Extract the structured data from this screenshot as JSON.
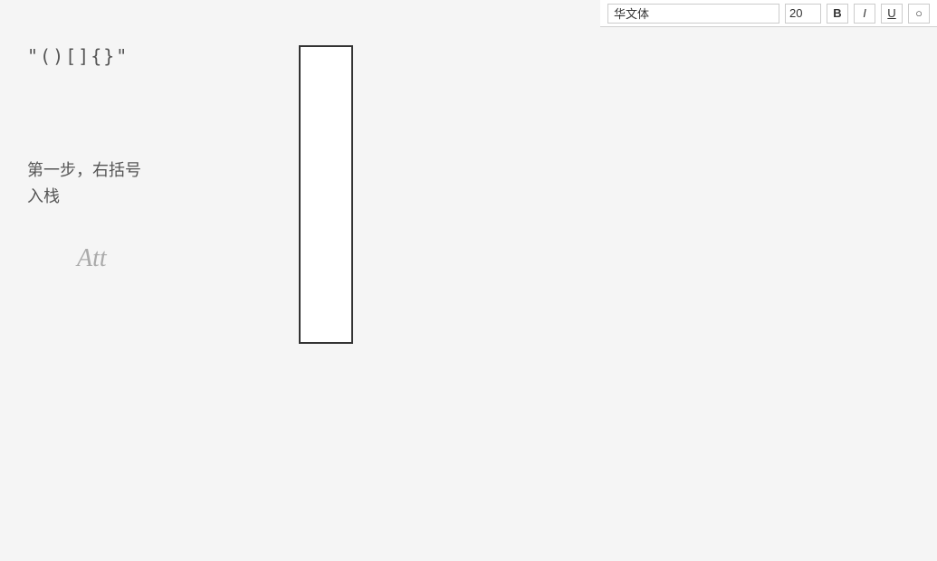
{
  "toolbar": {
    "font_label": "华文体",
    "font_size": "20",
    "bold_label": "B",
    "italic_label": "I",
    "underline_label": "U",
    "other_label": "○"
  },
  "content": {
    "symbols": "\"()[]{}\"",
    "att_text": "Att",
    "instruction_line1": "第一步，右括号",
    "instruction_line2": "入栈"
  }
}
